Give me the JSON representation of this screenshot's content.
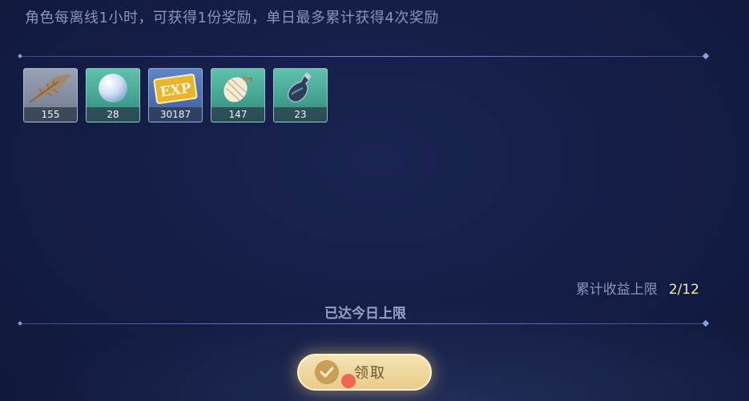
{
  "description": "角色每离线1小时，可获得1份奖励，单日最多累计获得4次奖励",
  "rewards": [
    {
      "icon": "feather-icon",
      "count": "155"
    },
    {
      "icon": "pearl-icon",
      "count": "28"
    },
    {
      "icon": "exp-ticket-icon",
      "count": "30187"
    },
    {
      "icon": "cotton-bag-icon",
      "count": "147"
    },
    {
      "icon": "potion-bottle-icon",
      "count": "23"
    }
  ],
  "limit": {
    "label": "累计收益上限",
    "value": "2/12"
  },
  "status_text": "已达今日上限",
  "claim_button": {
    "label": "领取"
  },
  "colors": {
    "background": "#141d45",
    "button": "#f4e3b3",
    "accent": "#f3e6b0"
  }
}
